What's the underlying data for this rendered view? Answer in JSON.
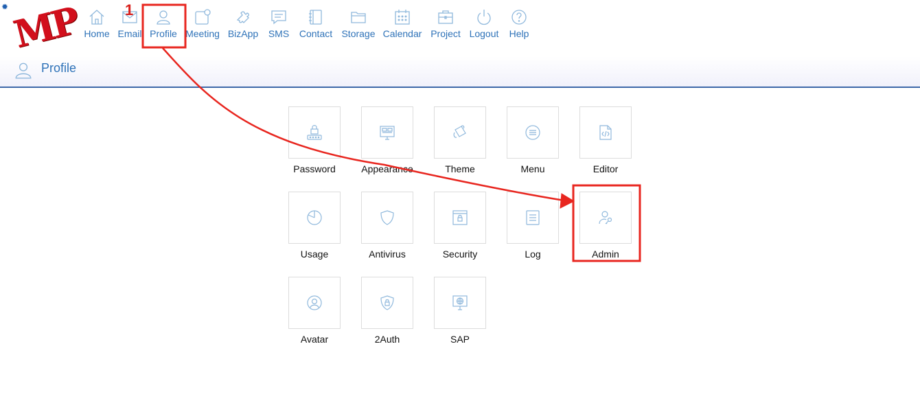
{
  "nav": {
    "items": [
      {
        "label": "Home",
        "icon": "home-icon"
      },
      {
        "label": "Email",
        "icon": "email-icon"
      },
      {
        "label": "Profile",
        "icon": "user-icon"
      },
      {
        "label": "Meeting",
        "icon": "meeting-icon"
      },
      {
        "label": "BizApp",
        "icon": "puzzle-icon"
      },
      {
        "label": "SMS",
        "icon": "message-icon"
      },
      {
        "label": "Contact",
        "icon": "contact-book-icon"
      },
      {
        "label": "Storage",
        "icon": "folder-icon"
      },
      {
        "label": "Calendar",
        "icon": "calendar-icon"
      },
      {
        "label": "Project",
        "icon": "briefcase-icon"
      },
      {
        "label": "Logout",
        "icon": "power-icon"
      },
      {
        "label": "Help",
        "icon": "question-icon"
      }
    ]
  },
  "logo": {
    "text": "MP"
  },
  "header": {
    "title": "Profile",
    "icon": "user-icon"
  },
  "tiles": [
    {
      "label": "Password",
      "icon": "lock-password-icon"
    },
    {
      "label": "Appearance",
      "icon": "monitor-layout-icon"
    },
    {
      "label": "Theme",
      "icon": "paint-bucket-icon"
    },
    {
      "label": "Menu",
      "icon": "menu-circle-icon"
    },
    {
      "label": "Editor",
      "icon": "code-file-icon"
    },
    {
      "label": "Usage",
      "icon": "pie-chart-icon"
    },
    {
      "label": "Antivirus",
      "icon": "shield-icon"
    },
    {
      "label": "Security",
      "icon": "lock-window-icon"
    },
    {
      "label": "Log",
      "icon": "document-lines-icon"
    },
    {
      "label": "Admin",
      "icon": "admin-user-key-icon"
    },
    {
      "label": "Avatar",
      "icon": "avatar-circle-icon"
    },
    {
      "label": "2Auth",
      "icon": "shield-lock-icon"
    },
    {
      "label": "SAP",
      "icon": "globe-monitor-icon"
    }
  ],
  "annotation": {
    "step": "1"
  },
  "colors": {
    "accent": "#2e72b8",
    "icon": "#8fb8dc",
    "highlight": "#e8261f",
    "divider": "#3d67a8"
  }
}
